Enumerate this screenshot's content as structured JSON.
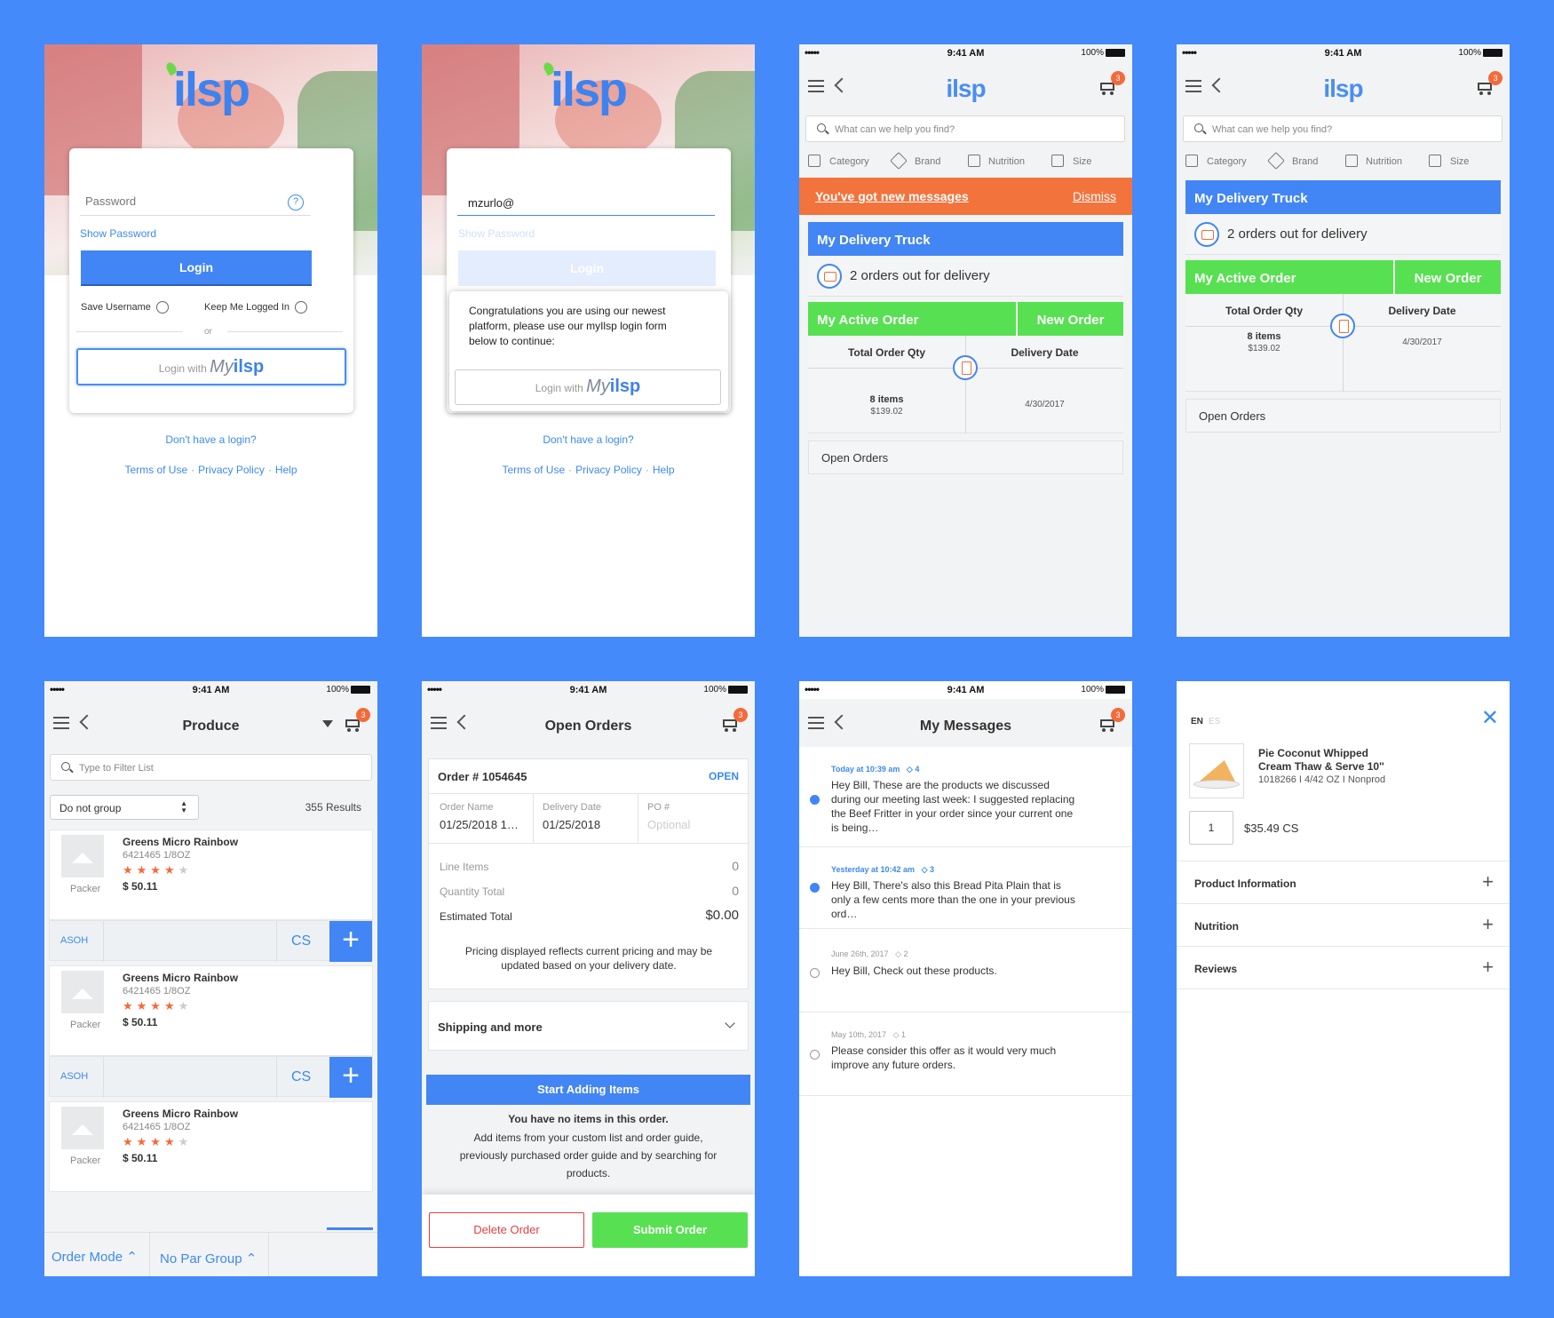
{
  "brand": {
    "name": "ilsp",
    "my": "My",
    "myname": "ilsp"
  },
  "status": {
    "signal": "•••••",
    "time": "9:41 AM",
    "battery": "100%"
  },
  "cart_count": "3",
  "login1": {
    "password_placeholder": "Password",
    "show_password": "Show Password",
    "login_label": "Login",
    "save_username": "Save Username",
    "keep_logged": "Keep Me Logged In",
    "or": "or",
    "login_with": "Login with",
    "no_login": "Don't have a login?",
    "terms": "Terms of Use",
    "privacy": "Privacy Policy",
    "help": "Help",
    "help_icon": "?"
  },
  "login2": {
    "username_value": "mzurlo@",
    "show_password": "Show Password",
    "login_label": "Login",
    "popup_text": "Congratulations you are using our newest platform, please use our myIlsp login form below to continue:",
    "login_with": "Login with",
    "no_login": "Don't have a login?",
    "terms": "Terms of Use",
    "privacy": "Privacy Policy",
    "help": "Help"
  },
  "home": {
    "search_placeholder": "What can we help you find?",
    "filters": [
      "Category",
      "Brand",
      "Nutrition",
      "Size"
    ],
    "banner": "You've got new messages",
    "dismiss": "Dismiss",
    "truck_title": "My Delivery Truck",
    "truck_status": "2 orders out for delivery",
    "active_order": "My Active Order",
    "new_order": "New Order",
    "total_qty_label": "Total Order Qty",
    "delivery_date_label": "Delivery Date",
    "items": "8 items",
    "price": "$139.02",
    "date": "4/30/2017",
    "open_orders": "Open Orders"
  },
  "produce": {
    "title": "Produce",
    "filter_placeholder": "Type to Filter List",
    "group_select": "Do not group",
    "results": "355 Results",
    "products": [
      {
        "name": "Greens Micro Rainbow",
        "code": "6421465 1/8OZ",
        "brand": "Packer",
        "price": "$ 50.11"
      },
      {
        "name": "Greens Micro Rainbow",
        "code": "6421465 1/8OZ",
        "brand": "Packer",
        "price": "$ 50.11"
      },
      {
        "name": "Greens Micro Rainbow",
        "code": "6421465 1/8OZ",
        "brand": "Packer",
        "price": "$ 50.11"
      }
    ],
    "rating": 4,
    "asoh": "ASOH",
    "unit": "CS",
    "plus": "+",
    "order_mode": "Order Mode",
    "par_group": "No Par Group"
  },
  "open_orders": {
    "title": "Open Orders",
    "order_no": "Order # 1054645",
    "status": "OPEN",
    "order_name_label": "Order Name",
    "order_name_value": "01/25/2018 1…",
    "delivery_label": "Delivery Date",
    "delivery_value": "01/25/2018",
    "po_label": "PO #",
    "po_placeholder": "Optional",
    "line_items_label": "Line Items",
    "line_items_value": "0",
    "qty_total_label": "Quantity Total",
    "qty_total_value": "0",
    "est_total_label": "Estimated Total",
    "est_total_value": "$0.00",
    "pricing_note": "Pricing displayed reflects current pricing and may be updated based on your delivery date.",
    "shipping": "Shipping and more",
    "start_adding": "Start Adding Items",
    "no_items": "You have no items in this order.",
    "add_items_help": "Add items from your custom list and order guide, previously purchased order guide and by searching for products.",
    "delete": "Delete Order",
    "submit": "Submit Order"
  },
  "messages": {
    "title": "My Messages",
    "list": [
      {
        "date": "Today at 10:39 am",
        "tags": "4",
        "text": "Hey Bill, These are the products we discussed during our meeting last week: I suggested replacing the Beef Fritter in your order since your current one is being…",
        "unread": true
      },
      {
        "date": "Yesterday at 10:42 am",
        "tags": "3",
        "text": "Hey Bill, There's also this Bread Pita Plain that is only a few cents more than the one in your previous ord…",
        "unread": true
      },
      {
        "date": "June 26th, 2017",
        "tags": "2",
        "text": "Hey Bill, Check out these products.",
        "unread": false
      },
      {
        "date": "May 10th, 2017",
        "tags": "1",
        "text": "Please consider this offer as it would very much improve any future orders.",
        "unread": false
      }
    ]
  },
  "detail": {
    "lang_en": "EN",
    "lang_es": "ES",
    "name_line1": "Pie Coconut Whipped",
    "name_line2": "Cream Thaw & Serve 10''",
    "meta": "1018266 I 4/42 OZ I Nonprod",
    "qty": "1",
    "price": "$35.49 CS",
    "sections": [
      "Product Information",
      "Nutrition",
      "Reviews"
    ]
  },
  "colors": {
    "primary": "#4285f4",
    "green": "#57e051",
    "orange": "#f46a3a",
    "background": "#448afa"
  }
}
